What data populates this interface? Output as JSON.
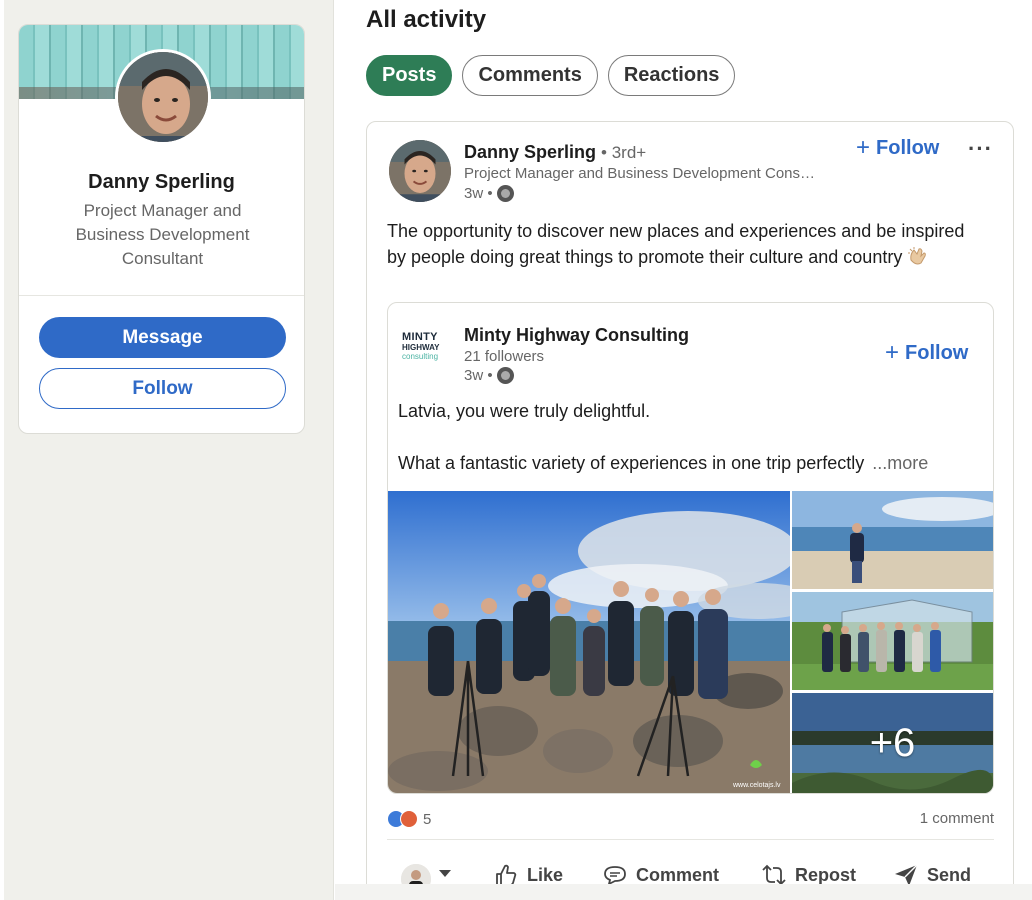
{
  "profile": {
    "name": "Danny Sperling",
    "headline": "Project Manager and Business Development Consultant",
    "message_label": "Message",
    "follow_label": "Follow"
  },
  "activity": {
    "title": "All activity",
    "tabs": [
      {
        "label": "Posts",
        "active": true
      },
      {
        "label": "Comments",
        "active": false
      },
      {
        "label": "Reactions",
        "active": false
      }
    ]
  },
  "post": {
    "author_name": "Danny Sperling",
    "author_degree": "• 3rd+",
    "author_headline": "Project Manager and Business Development Cons…",
    "time": "3w •",
    "follow_label": "Follow",
    "more_label": "···",
    "text": "The opportunity to discover new places and experiences and be inspired by people doing great things to promote their culture and country",
    "shared": {
      "logo_line1": "MINTY",
      "logo_line2": "HIGHWAY",
      "logo_line3": "consulting",
      "company_name": "Minty Highway Consulting",
      "followers": "21 followers",
      "time": "3w •",
      "follow_label": "Follow",
      "text_line1": "Latvia, you were truly delightful.",
      "text_line2": "What a fantastic variety of experiences in one trip perfectly",
      "see_more": "...more",
      "extra_photos": "+6",
      "watermark": "www.celotajs.lv"
    },
    "reaction_count": "5",
    "comment_count": "1 comment",
    "actions": {
      "like": "Like",
      "comment": "Comment",
      "repost": "Repost",
      "send": "Send"
    }
  },
  "colors": {
    "brand_blue": "#2f6ac7",
    "active_tab_green": "#2e7d56",
    "sidebar_bg": "#f0f0eb"
  }
}
